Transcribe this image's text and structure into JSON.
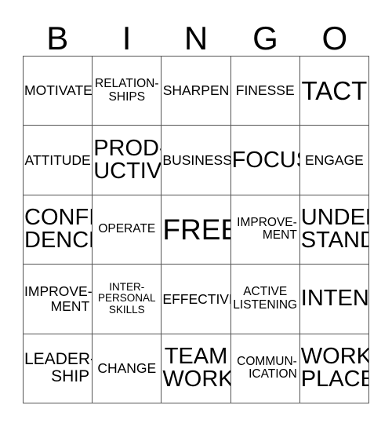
{
  "card": {
    "title": "BINGO Card",
    "header_letters": [
      "B",
      "I",
      "N",
      "G",
      "O"
    ],
    "border_color": "#555555",
    "text_color": "#000000",
    "background_color": "#ffffff",
    "rows": 5,
    "columns": 5,
    "free_space": "FREE",
    "cells": [
      {
        "text": "MOTIVATE",
        "size": "md",
        "align": "center"
      },
      {
        "text": "RELATION-\nSHIPS",
        "size": "sm",
        "align": "center"
      },
      {
        "text": "SHARPEN",
        "size": "md",
        "align": "center"
      },
      {
        "text": "FINESSE",
        "size": "md",
        "align": "center"
      },
      {
        "text": "TACT",
        "size": "3xl",
        "align": "center"
      },
      {
        "text": "ATTITUDE",
        "size": "md",
        "align": "center"
      },
      {
        "text": "PROD-\nUCTIVE",
        "size": "xxl",
        "align": "center"
      },
      {
        "text": "BUSINESS",
        "size": "md",
        "align": "center"
      },
      {
        "text": "FOCUS",
        "size": "xxl",
        "align": "center"
      },
      {
        "text": "ENGAGE",
        "size": "md",
        "align": "center"
      },
      {
        "text": "CONFI-\nDENCE",
        "size": "xxl",
        "align": "center"
      },
      {
        "text": "OPERATE",
        "size": "sm",
        "align": "center"
      },
      {
        "text": "FREE",
        "size": "4xl",
        "align": "center"
      },
      {
        "text": "IMPROVE-\nMENT",
        "size": "sm",
        "align": "right"
      },
      {
        "text": "UNDER-\nSTAND",
        "size": "xxl",
        "align": "center"
      },
      {
        "text": "IMPROVE-\nMENT",
        "size": "md",
        "align": "right"
      },
      {
        "text": "INTER-\nPERSONAL\nSKILLS",
        "size": "xs",
        "align": "center"
      },
      {
        "text": "EFFECTIVE",
        "size": "md",
        "align": "center"
      },
      {
        "text": "ACTIVE\nLISTENING",
        "size": "sm",
        "align": "center"
      },
      {
        "text": "INTENT",
        "size": "xxl",
        "align": "center"
      },
      {
        "text": "LEADER-\nSHIP",
        "size": "lg",
        "align": "right"
      },
      {
        "text": "CHANGE",
        "size": "md",
        "align": "center"
      },
      {
        "text": "TEAM\nWORK",
        "size": "xxl",
        "align": "center"
      },
      {
        "text": "COMMUN-\nICATION",
        "size": "sm",
        "align": "right"
      },
      {
        "text": "WORK-\nPLACE",
        "size": "xxl",
        "align": "center"
      }
    ]
  }
}
